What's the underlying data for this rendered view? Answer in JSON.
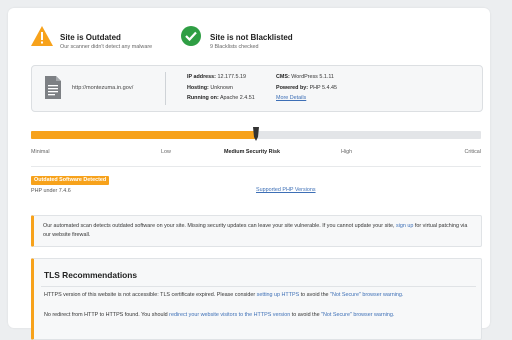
{
  "status": {
    "outdated": {
      "title": "Site is Outdated",
      "subtitle": "Our scanner didn't detect any malware"
    },
    "blacklist": {
      "title": "Site is not Blacklisted",
      "subtitle": "9 Blacklists checked"
    }
  },
  "site": {
    "url": "http://montezuma.in.gov/",
    "ip_label": "IP address:",
    "ip": "12.177.5.19",
    "hosting_label": "Hosting:",
    "hosting": "Unknown",
    "running_label": "Running on:",
    "running": "Apache 2.4.51",
    "cms_label": "CMS:",
    "cms": "WordPress 5.1.11",
    "powered_label": "Powered by:",
    "powered": "PHP 5.4.45",
    "more_details": "More Details"
  },
  "risk": {
    "level_fraction": 0.5,
    "labels": [
      "Minimal",
      "Low",
      "Medium Security Risk",
      "High",
      "Critical"
    ]
  },
  "software": {
    "tag": "Outdated Software Detected",
    "php_under": "PHP under 7.4.6",
    "supported_link": "Supported PHP Versions"
  },
  "notice": {
    "text1": "Our automated scan detects outdated software on your site. Missing security updates can leave your site vulnerable. If you cannot update your site,",
    "link1": "sign up",
    "text2": "for virtual patching via our website firewall."
  },
  "tls": {
    "title": "TLS Recommendations",
    "line1_a": "HTTPS version of this website is not accessible: TLS certificate expired. Please consider",
    "line1_link1": "setting up HTTPS",
    "line1_b": "to avoid the",
    "line1_link2": "\"Not Secure\" browser warning.",
    "line2_a": "No redirect from HTTP to HTTPS found. You should",
    "line2_link1": "redirect your website visitors to the HTTPS version",
    "line2_b": "to avoid the",
    "line2_link2": "\"Not Secure\" browser warning."
  },
  "colors": {
    "accent": "#f7a21b",
    "success": "#2f9e44",
    "link": "#3d6fb6"
  }
}
